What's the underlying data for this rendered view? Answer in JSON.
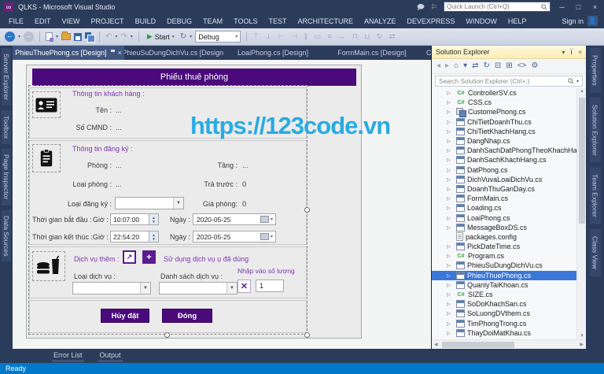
{
  "titlebar": {
    "app_title": "QLKS - Microsoft Visual Studio",
    "quick_launch_placeholder": "Quick Launch (Ctrl+Q)",
    "minimize": "─",
    "maximize": "□",
    "close": "×",
    "feedback_icon_glyph": "🗩",
    "notifications_icon_glyph": "⚐"
  },
  "menubar": {
    "items": [
      "FILE",
      "EDIT",
      "VIEW",
      "PROJECT",
      "BUILD",
      "DEBUG",
      "TEAM",
      "TOOLS",
      "TEST",
      "ARCHITECTURE",
      "ANALYZE",
      "DEVEXPRESS",
      "WINDOW",
      "HELP"
    ],
    "sign_in_label": "Sign in"
  },
  "toolbar": {
    "start_label": "Start",
    "config_value": "Debug",
    "back_glyph": "←",
    "forward_glyph": "→",
    "undo_glyph": "↶",
    "redo_glyph": "↷",
    "refresh_glyph": "↻",
    "misc_icons": "⊤ ⊥ ⊢ ⊣ ∥ ▭ ≡ ↔ ⊓ ⊔ ↻ ⇄"
  },
  "docks": {
    "left_tabs": [
      "Server Explorer",
      "Toolbox",
      "Page Inspector",
      "Data Sources"
    ],
    "right_tabs": [
      "Properties",
      "Solution Explorer",
      "Team Explorer",
      "Class View"
    ]
  },
  "doc_tabs": [
    {
      "label": "PhieuThuePhong.cs [Design]",
      "active": true
    },
    {
      "label": "PhieuSuDungDichVu.cs [Design]",
      "active": false
    },
    {
      "label": "LoaiPhong.cs [Design]",
      "active": false
    },
    {
      "label": "FormMain.cs [Design]",
      "active": false
    },
    {
      "label": "C",
      "active": false
    }
  ],
  "watermark_text": "https://123code.vn",
  "designer_form": {
    "title": "Phiếu thuê phòng",
    "customer_section": {
      "header": "Thông tin khách hàng :",
      "name_label": "Tên :",
      "name_value": "...",
      "id_label": "Số CMND :",
      "id_value": "..."
    },
    "booking_section": {
      "header": "Thông tin đăng ký :",
      "room_label": "Phòng :",
      "room_value": "...",
      "floor_label": "Tầng :",
      "floor_value": "...",
      "room_type_label": "Loại phòng :",
      "room_type_value": "...",
      "prepaid_label": "Trả trước :",
      "prepaid_value": "0",
      "reg_type_label": "Loại đăng ký :",
      "price_label": "Giá phòng:",
      "price_value": "0",
      "start_label": "Thời gian bắt đầu :",
      "end_label": "Thời gian kết thúc :",
      "hour_label": "Giờ :",
      "date_label": "Ngày :",
      "start_time": "10:07:00",
      "end_time": "22:54:20",
      "start_date": "2020-05-25",
      "end_date": "2020-05-25"
    },
    "service_section": {
      "header": "Dịch vụ thêm :",
      "open_icon_glyph": "↗",
      "add_icon_glyph": "+",
      "clear_icon_glyph": "✕",
      "used_services_link": "Sử dụng dịch vụ ụ đã dùng",
      "service_type_label": "Loại dịch vụ :",
      "service_list_label": "Danh sách dịch vụ :",
      "quantity_label": "Nhập vào số lượng",
      "quantity_value": "1"
    },
    "cancel_button": "Hủy đặt",
    "close_button": "Đóng"
  },
  "solution_explorer": {
    "title": "Solution Explorer",
    "search_placeholder": "Search Solution Explorer (Ctrl+;)",
    "header_icons": [
      {
        "name": "window-position-icon",
        "glyph": "▾"
      },
      {
        "name": "auto-hide-pin-icon",
        "glyph": ""
      },
      {
        "name": "close-panel-icon",
        "glyph": "×"
      }
    ],
    "toolbar_icons": [
      {
        "name": "back-icon",
        "glyph": "◂",
        "dim": true
      },
      {
        "name": "forward-icon",
        "glyph": "▸",
        "dim": true
      },
      {
        "name": "home-icon",
        "glyph": "⌂",
        "dim": false
      },
      {
        "name": "switch-views-icon",
        "glyph": "▾",
        "dim": false
      },
      {
        "name": "sync-with-active-document-icon",
        "glyph": "⇄",
        "dim": false
      },
      {
        "name": "refresh-icon",
        "glyph": "↻",
        "dim": false
      },
      {
        "name": "collapse-all-icon",
        "glyph": "⊟",
        "dim": false
      },
      {
        "name": "show-all-files-icon",
        "glyph": "⊞",
        "dim": false
      },
      {
        "name": "view-code-icon",
        "glyph": "<>",
        "dim": false
      },
      {
        "name": "properties-icon",
        "glyph": "⚙",
        "dim": false
      }
    ],
    "files": [
      {
        "name": "ControllerSV.cs",
        "icon": "csharp",
        "selected": false
      },
      {
        "name": "CSS.cs",
        "icon": "csharp",
        "selected": false
      },
      {
        "name": "CustomePhong.cs",
        "icon": "component",
        "selected": false
      },
      {
        "name": "ChiTietDoanhThu.cs",
        "icon": "form",
        "selected": false
      },
      {
        "name": "ChiTietKhachHang.cs",
        "icon": "form",
        "selected": false
      },
      {
        "name": "DangNhap.cs",
        "icon": "form",
        "selected": false
      },
      {
        "name": "DanhSachDatPhongTheoKhachHang.cs",
        "icon": "form",
        "selected": false
      },
      {
        "name": "DanhSachKhachHang.cs",
        "icon": "form",
        "selected": false
      },
      {
        "name": "DatPhong.cs",
        "icon": "form",
        "selected": false
      },
      {
        "name": "DichVuvaLoaiDichVu.cs",
        "icon": "form",
        "selected": false
      },
      {
        "name": "DoanhThuGanDay.cs",
        "icon": "form",
        "selected": false
      },
      {
        "name": "FormMain.cs",
        "icon": "form",
        "selected": false
      },
      {
        "name": "Loading.cs",
        "icon": "form",
        "selected": false
      },
      {
        "name": "LoaiPhong.cs",
        "icon": "form",
        "selected": false
      },
      {
        "name": "MessageBoxDS.cs",
        "icon": "form",
        "selected": false
      },
      {
        "name": "packages.config",
        "icon": "config",
        "selected": false,
        "no_expander": true
      },
      {
        "name": "PickDateTime.cs",
        "icon": "form",
        "selected": false
      },
      {
        "name": "Program.cs",
        "icon": "csharp",
        "selected": false
      },
      {
        "name": "PhieuSuDungDichVu.cs",
        "icon": "form",
        "selected": false
      },
      {
        "name": "PhieuThuePhong.cs",
        "icon": "form",
        "selected": true
      },
      {
        "name": "QuanlyTaiKhoan.cs",
        "icon": "form",
        "selected": false
      },
      {
        "name": "SIZE.cs",
        "icon": "csharp",
        "selected": false
      },
      {
        "name": "SoDoKhachSan.cs",
        "icon": "form",
        "selected": false
      },
      {
        "name": "SoLuongDVthem.cs",
        "icon": "form",
        "selected": false
      },
      {
        "name": "TimPhongTrong.cs",
        "icon": "form",
        "selected": false
      },
      {
        "name": "ThayDoiMatKhau.cs",
        "icon": "form",
        "selected": false
      }
    ]
  },
  "bottom_panel": {
    "tabs": [
      "Error List",
      "Output"
    ]
  },
  "status_bar": {
    "text": "Ready"
  },
  "colors": {
    "accent_purple": "#4B0A7B",
    "label_purple": "#7A35B0",
    "watermark_blue": "#29ABE2",
    "status_blue": "#0079CB",
    "chrome_navy": "#2B3C5B",
    "selection_blue": "#3B77D8",
    "solution_header_yellow": "#FBEDB0"
  }
}
